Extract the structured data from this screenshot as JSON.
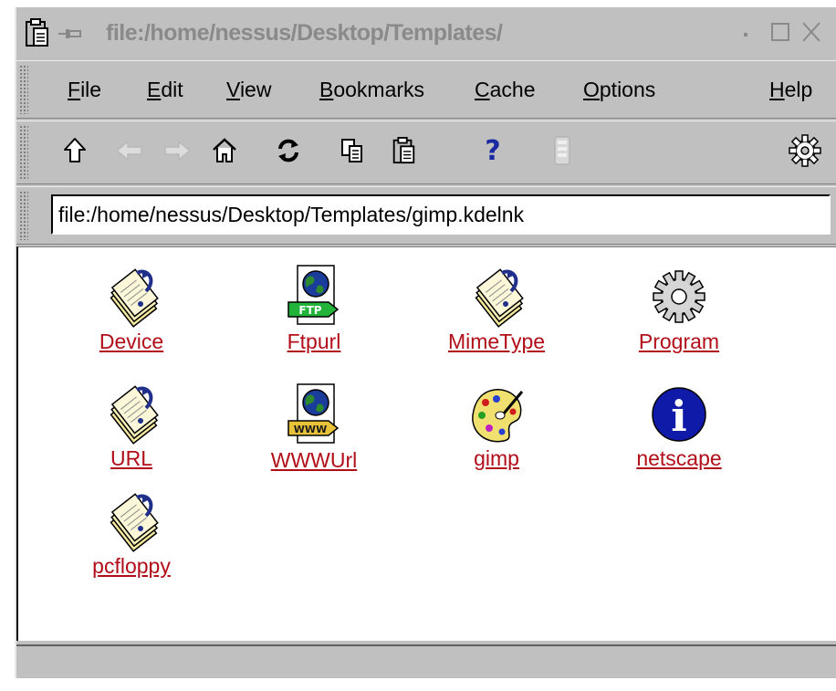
{
  "window": {
    "title": "file:/home/nessus/Desktop/Templates/"
  },
  "menubar": {
    "items": [
      {
        "label_ul": "F",
        "label_rest": "ile"
      },
      {
        "label_ul": "E",
        "label_rest": "dit"
      },
      {
        "label_ul": "V",
        "label_rest": "iew"
      },
      {
        "label_ul": "B",
        "label_rest": "ookmarks"
      },
      {
        "label_ul": "C",
        "label_rest": "ache"
      },
      {
        "label_ul": "O",
        "label_rest": "ptions"
      },
      {
        "label_ul": "H",
        "label_rest": "elp"
      }
    ]
  },
  "toolbar": {
    "icons": [
      "up-arrow-icon",
      "back-arrow-icon",
      "forward-arrow-icon",
      "home-icon",
      "reload-icon",
      "copy-icon",
      "paste-icon",
      "help-icon",
      "stop-icon",
      "gear-icon"
    ],
    "help_glyph": "?"
  },
  "location": {
    "url": "file:/home/nessus/Desktop/Templates/gimp.kdelnk"
  },
  "files": [
    {
      "name": "Device",
      "icon": "kdelnk-document-icon"
    },
    {
      "name": "Ftpurl",
      "icon": "ftp-globe-icon"
    },
    {
      "name": "MimeType",
      "icon": "kdelnk-document-icon"
    },
    {
      "name": "Program",
      "icon": "gear-icon"
    },
    {
      "name": "URL",
      "icon": "kdelnk-document-icon"
    },
    {
      "name": "WWWUrl",
      "icon": "www-globe-icon"
    },
    {
      "name": "gimp",
      "icon": "paint-palette-icon"
    },
    {
      "name": "netscape",
      "icon": "info-icon"
    },
    {
      "name": "pcfloppy",
      "icon": "kdelnk-document-icon"
    }
  ],
  "badges": {
    "ftp": "FTP",
    "www": "WWW",
    "info": "i"
  },
  "statusbar": {
    "text": ""
  },
  "colors": {
    "link": "#b10e1a",
    "chrome": "#c0c0c0",
    "help_blue": "#1a2aa0"
  }
}
